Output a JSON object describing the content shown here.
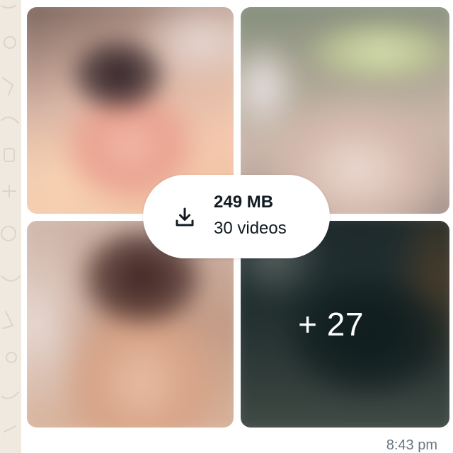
{
  "media_group": {
    "thumbnails": [
      {
        "label": "video-thumbnail-1"
      },
      {
        "label": "video-thumbnail-2"
      },
      {
        "label": "video-thumbnail-3"
      },
      {
        "label": "video-thumbnail-4"
      }
    ],
    "more_count": "+ 27"
  },
  "download": {
    "size": "249 MB",
    "count": "30 videos",
    "icon": "download-icon"
  },
  "message": {
    "timestamp": "8:43 pm"
  },
  "colors": {
    "bubble_bg": "#ffffff",
    "wallpaper": "#efeae2",
    "text_primary": "#111b21",
    "text_secondary": "#667781"
  }
}
